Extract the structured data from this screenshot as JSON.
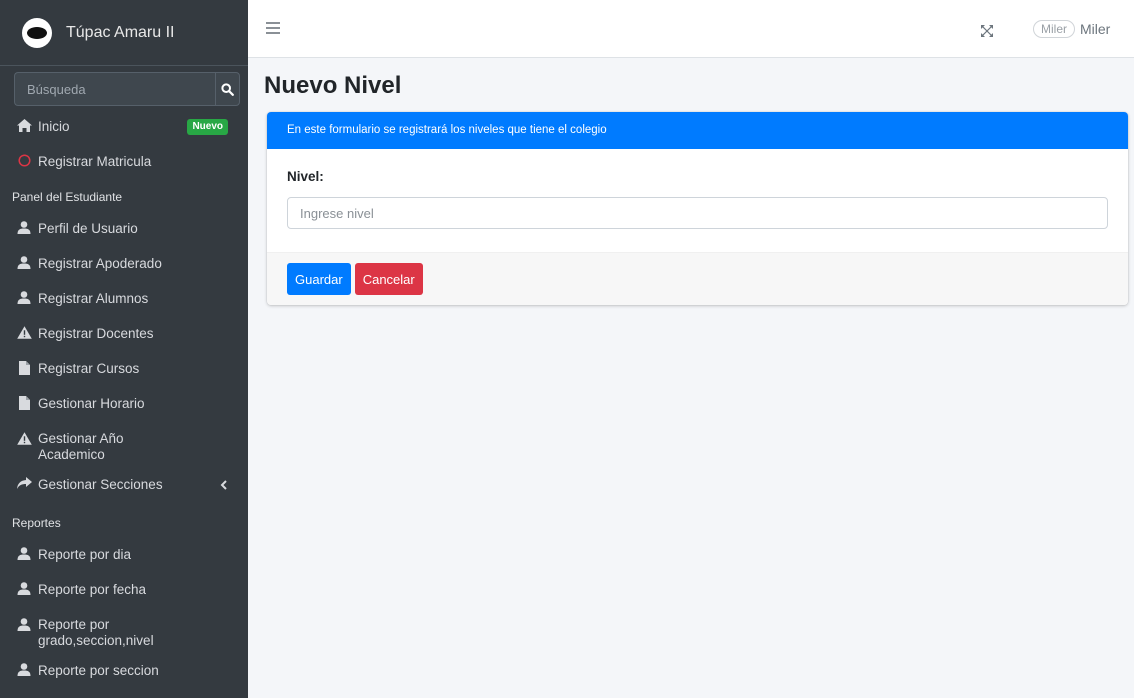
{
  "brand": {
    "name": "Túpac Amaru II"
  },
  "search": {
    "placeholder": "Búsqueda"
  },
  "sidebar": {
    "home": {
      "label": "Inicio",
      "badge": "Nuevo"
    },
    "register_enrollment": "Registrar Matricula",
    "section_student_panel": "Panel del Estudiante",
    "items_student": [
      "Perfil de Usuario",
      "Registrar Apoderado",
      "Registrar Alumnos",
      "Registrar Docentes",
      "Registrar Cursos",
      "Gestionar Horario",
      "Gestionar Año Academico",
      "Gestionar Secciones"
    ],
    "section_reports": "Reportes",
    "items_reports": [
      "Reporte por dia",
      "Reporte por fecha",
      "Reporte por grado,seccion,nivel",
      "Reporte por seccion"
    ]
  },
  "topbar": {
    "user_image_alt": "Miler",
    "user_name": "Miler"
  },
  "page": {
    "title": "Nuevo Nivel",
    "card_header": "En este formulario se registrará los niveles que tiene el colegio",
    "field_label": "Nivel:",
    "field_placeholder": "Ingrese nivel",
    "field_value": "",
    "save_label": "Guardar",
    "cancel_label": "Cancelar"
  },
  "colors": {
    "sidebar_bg": "#343a40",
    "primary": "#007bff",
    "danger": "#dc3545",
    "success_badge": "#28a745"
  }
}
